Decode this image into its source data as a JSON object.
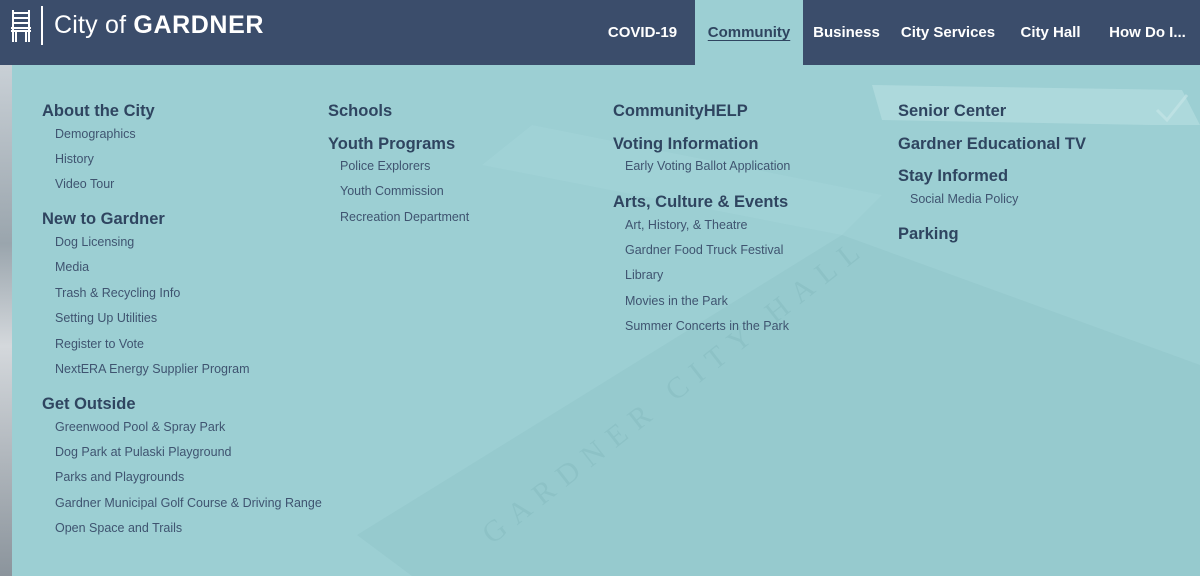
{
  "brand": {
    "city_prefix": "City of",
    "city_name": "GARDNER"
  },
  "nav": {
    "items": [
      "COVID-19",
      "Community",
      "Business",
      "City Services",
      "City Hall",
      "How Do I..."
    ],
    "active": "Community"
  },
  "menu": {
    "col1": {
      "about": {
        "heading": "About the City",
        "links": [
          "Demographics",
          "History",
          "Video Tour"
        ]
      },
      "new": {
        "heading": "New to Gardner",
        "links": [
          "Dog Licensing",
          "Media",
          "Trash & Recycling Info",
          "Setting Up Utilities",
          "Register to Vote",
          "NextERA Energy Supplier Program"
        ]
      },
      "outside": {
        "heading": "Get Outside",
        "links": [
          "Greenwood Pool & Spray Park",
          "Dog Park at Pulaski Playground",
          "Parks and Playgrounds",
          "Gardner Municipal Golf Course & Driving Range",
          "Open Space and Trails"
        ]
      }
    },
    "col2": {
      "schools": {
        "heading": "Schools"
      },
      "youth": {
        "heading": "Youth Programs",
        "links": [
          "Police Explorers",
          "Youth Commission",
          "Recreation Department"
        ]
      }
    },
    "col3": {
      "help": {
        "heading": "CommunityHELP"
      },
      "voting": {
        "heading": "Voting Information",
        "links": [
          "Early Voting Ballot Application"
        ]
      },
      "arts": {
        "heading": "Arts, Culture & Events",
        "links": [
          "Art, History, & Theatre",
          "Gardner Food Truck Festival",
          "Library",
          "Movies in the Park",
          "Summer Concerts in the Park"
        ]
      }
    },
    "col4": {
      "senior": {
        "heading": "Senior Center"
      },
      "tv": {
        "heading": "Gardner Educational TV"
      },
      "informed": {
        "heading": "Stay Informed",
        "links": [
          "Social Media Policy"
        ]
      },
      "parking": {
        "heading": "Parking"
      }
    }
  },
  "background": {
    "engraving": "GARDNER CITY HALL"
  },
  "colors": {
    "header": "#3b4d6b",
    "panel": "#9ccfd3",
    "heading_text": "#2f4560",
    "link_text": "#3f5470"
  }
}
